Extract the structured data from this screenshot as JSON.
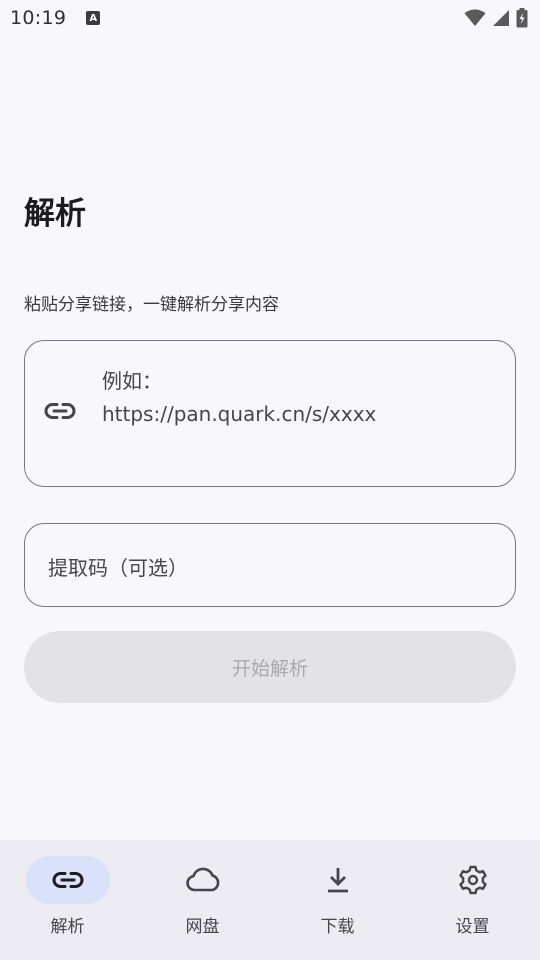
{
  "status_bar": {
    "time": "10:19",
    "notification_icon_glyph": "A",
    "icons": [
      "wifi-icon",
      "signal-icon",
      "battery-charging-icon"
    ]
  },
  "page": {
    "title": "解析",
    "subtitle": "粘贴分享链接，一键解析分享内容"
  },
  "link_input": {
    "icon": "link-icon",
    "placeholder": "例如：\nhttps://pan.quark.cn/s/xxxx",
    "value": ""
  },
  "code_input": {
    "placeholder": "提取码（可选）",
    "value": ""
  },
  "start_button": {
    "label": "开始解析",
    "enabled": false
  },
  "bottom_nav": {
    "items": [
      {
        "label": "解析",
        "icon": "link-icon",
        "active": true
      },
      {
        "label": "网盘",
        "icon": "cloud-icon",
        "active": false
      },
      {
        "label": "下载",
        "icon": "download-icon",
        "active": false
      },
      {
        "label": "设置",
        "icon": "gear-icon",
        "active": false
      }
    ]
  },
  "colors": {
    "background": "#f8f7fc",
    "nav_background": "#edecf2",
    "nav_active_pill": "#dae2f9",
    "button_disabled_bg": "#e3e2e7",
    "button_disabled_text": "#a9a8ad",
    "outline": "#7a7680"
  }
}
